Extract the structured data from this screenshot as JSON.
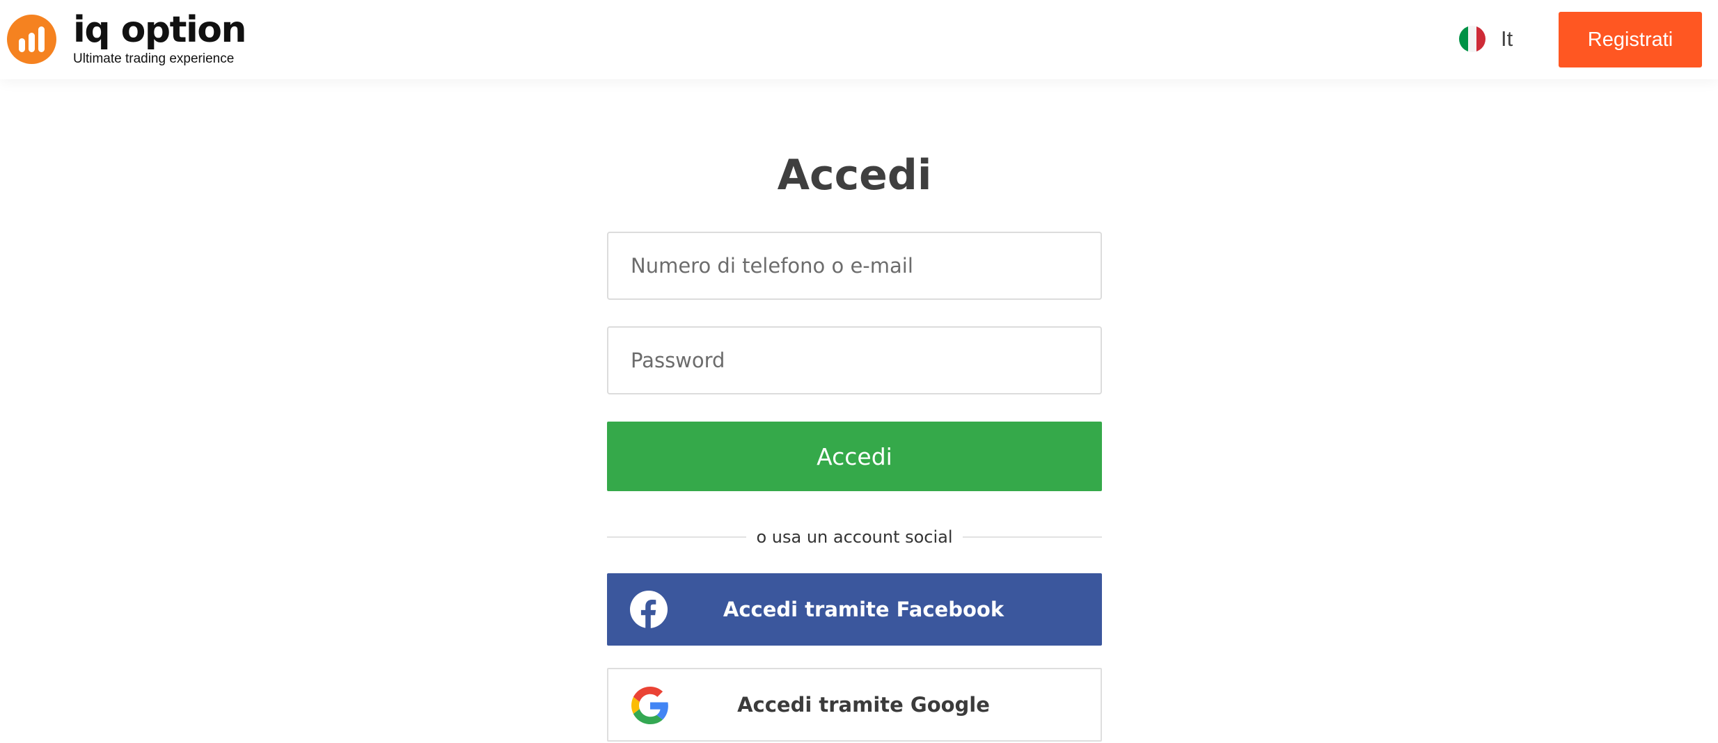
{
  "header": {
    "logo": {
      "wordmark": "iq option",
      "tagline": "Ultimate trading experience"
    },
    "language": {
      "label": "It",
      "flag": "italy-flag-icon"
    },
    "register_label": "Registrati"
  },
  "login": {
    "title": "Accedi",
    "email_placeholder": "Numero di telefono o e-mail",
    "email_value": "",
    "password_placeholder": "Password",
    "password_value": "",
    "submit_label": "Accedi",
    "divider_text": "o usa un account social",
    "facebook_label": "Accedi tramite Facebook",
    "google_label": "Accedi tramite Google"
  },
  "colors": {
    "brand_orange": "#f58220",
    "register_button": "#ff5722",
    "submit_button": "#35a94a",
    "facebook_button": "#3b579d",
    "title_text": "#3f3f3f"
  },
  "icons": {
    "logo": "iq-option-logo-icon",
    "flag": "italy-flag-icon",
    "facebook": "facebook-icon",
    "google": "google-icon"
  }
}
